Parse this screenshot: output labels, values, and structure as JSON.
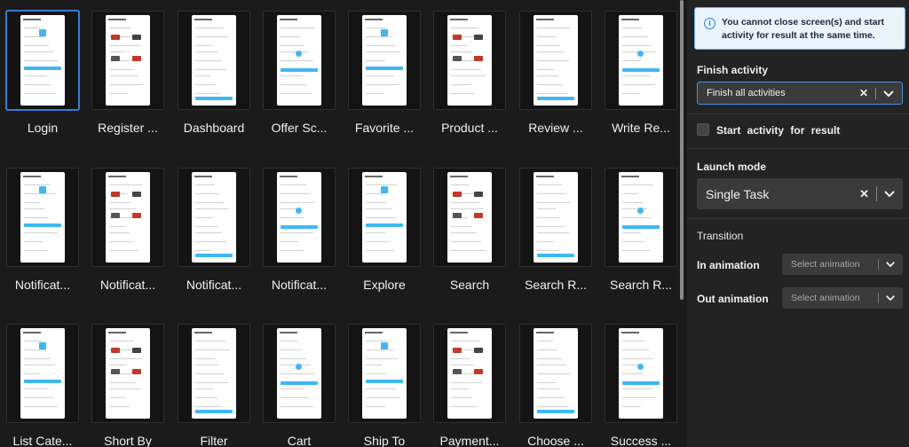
{
  "screens": [
    {
      "label": "Login",
      "selected": true
    },
    {
      "label": "Register ...",
      "selected": false
    },
    {
      "label": "Dashboard",
      "selected": false
    },
    {
      "label": "Offer Sc...",
      "selected": false
    },
    {
      "label": "Favorite ...",
      "selected": false
    },
    {
      "label": "Product ...",
      "selected": false
    },
    {
      "label": "Review ...",
      "selected": false
    },
    {
      "label": "Write Re...",
      "selected": false
    },
    {
      "label": "Notificat...",
      "selected": false
    },
    {
      "label": "Notificat...",
      "selected": false
    },
    {
      "label": "Notificat...",
      "selected": false
    },
    {
      "label": "Notificat...",
      "selected": false
    },
    {
      "label": "Explore",
      "selected": false
    },
    {
      "label": "Search",
      "selected": false
    },
    {
      "label": "Search R...",
      "selected": false
    },
    {
      "label": "Search R...",
      "selected": false
    },
    {
      "label": "List Cate...",
      "selected": false
    },
    {
      "label": "Short By",
      "selected": false
    },
    {
      "label": "Filter",
      "selected": false
    },
    {
      "label": "Cart",
      "selected": false
    },
    {
      "label": "Ship To",
      "selected": false
    },
    {
      "label": "Payment...",
      "selected": false
    },
    {
      "label": "Choose ...",
      "selected": false
    },
    {
      "label": "Success ...",
      "selected": false
    }
  ],
  "panel": {
    "info": {
      "icon": "info-icon",
      "glyph": "i",
      "text": "You cannot close screen(s) and start activity for result at the same time."
    },
    "finish_activity": {
      "title": "Finish activity",
      "value": "Finish all activities",
      "clear_glyph": "✕"
    },
    "start_for_result": {
      "label": "Start  activity  for  result",
      "checked": false
    },
    "launch_mode": {
      "title": "Launch mode",
      "value": "Single Task",
      "clear_glyph": "✕"
    },
    "transition": {
      "title": "Transition",
      "in_label": "In animation",
      "in_placeholder": "Select animation",
      "out_label": "Out animation",
      "out_placeholder": "Select animation"
    }
  },
  "colors": {
    "accent": "#3fb7f2",
    "selection": "#3a7bd5",
    "info_bg": "#eaf4fc",
    "info_border": "#6aaee6"
  }
}
